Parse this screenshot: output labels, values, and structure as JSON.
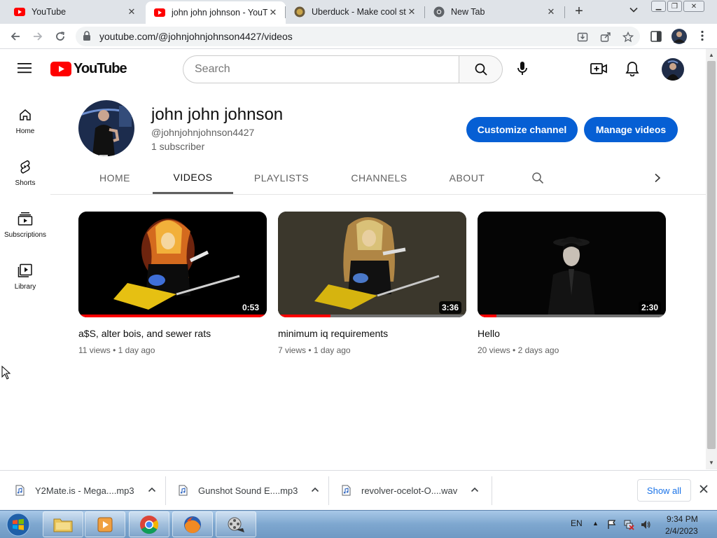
{
  "browser": {
    "tabs": [
      {
        "title": "YouTube",
        "favicon": "youtube-icon",
        "active": false
      },
      {
        "title": "john john johnson - YouT",
        "favicon": "youtube-icon",
        "active": true
      },
      {
        "title": "Uberduck - Make cool stu",
        "favicon": "uberduck-icon",
        "active": false
      },
      {
        "title": "New Tab",
        "favicon": "chrome-icon",
        "active": false
      }
    ],
    "url": "youtube.com/@johnjohnjohnson4427/videos"
  },
  "masthead": {
    "logo_text": "YouTube",
    "search_placeholder": "Search"
  },
  "guide": {
    "items": [
      {
        "label": "Home",
        "icon": "home-icon"
      },
      {
        "label": "Shorts",
        "icon": "shorts-icon"
      },
      {
        "label": "Subscriptions",
        "icon": "subscriptions-icon"
      },
      {
        "label": "Library",
        "icon": "library-icon"
      }
    ]
  },
  "channel": {
    "name": "john john johnson",
    "handle": "@johnjohnjohnson4427",
    "subscribers": "1 subscriber",
    "customize_label": "Customize channel",
    "manage_label": "Manage videos",
    "tabs": [
      "HOME",
      "VIDEOS",
      "PLAYLISTS",
      "CHANNELS",
      "ABOUT"
    ],
    "selected_tab": "VIDEOS"
  },
  "videos": [
    {
      "title": "a$S, alter bois, and sewer rats",
      "views": "11 views",
      "age": "1 day ago",
      "duration": "0:53",
      "watched_fraction": 0.99
    },
    {
      "title": "minimum iq requirements",
      "views": "7 views",
      "age": "1 day ago",
      "duration": "3:36",
      "watched_fraction": 0.28
    },
    {
      "title": "Hello",
      "views": "20 views",
      "age": "2 days ago",
      "duration": "2:30",
      "watched_fraction": 0.1
    }
  ],
  "downloads": {
    "items": [
      {
        "name": "Y2Mate.is - Mega....mp3"
      },
      {
        "name": "Gunshot Sound E....mp3"
      },
      {
        "name": "revolver-ocelot-O....wav"
      }
    ],
    "show_all_label": "Show all"
  },
  "taskbar": {
    "language": "EN",
    "time": "9:34 PM",
    "date": "2/4/2023"
  },
  "colors": {
    "brand_red": "#ff0000",
    "primary_button": "#065fd4"
  }
}
